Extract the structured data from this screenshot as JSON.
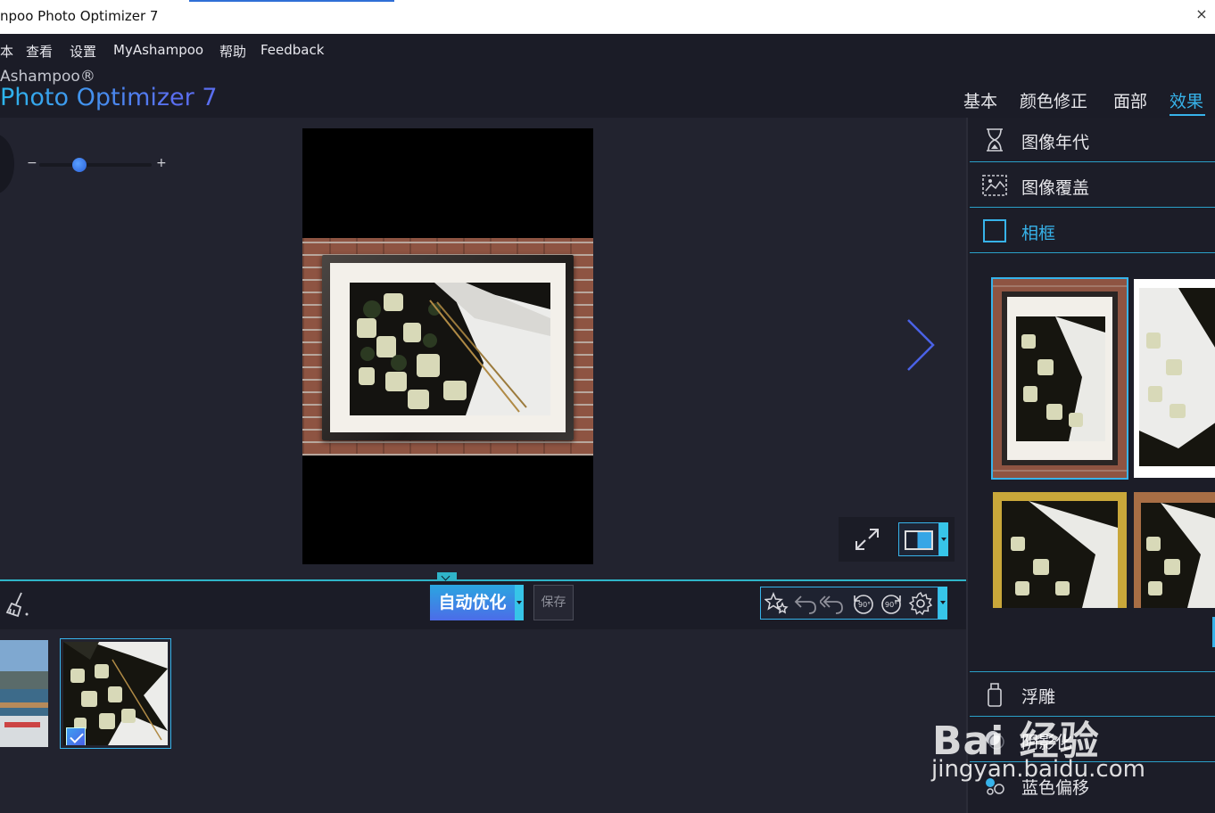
{
  "window": {
    "title": "npoo Photo Optimizer 7",
    "close_glyph": "×"
  },
  "menu": [
    "本",
    "查看",
    "设置",
    "MyAshampoo",
    "帮助",
    "Feedback"
  ],
  "brand": {
    "small": "Ashampoo®",
    "big": "Photo Optimizer 7"
  },
  "tabs": [
    "基本",
    "颜色修正",
    "面部",
    "效果"
  ],
  "active_tab": "效果",
  "zoom": {
    "minus": "−",
    "plus": "+",
    "level": 0.36
  },
  "toolbar": {
    "auto_label": "自动优化",
    "save_label": "保存"
  },
  "effects_top": [
    "图像年代",
    "图像覆盖",
    "相框"
  ],
  "active_effect": "相框",
  "effects_bottom": [
    "浮雕",
    "阴影化",
    "蓝色偏移"
  ],
  "watermark": {
    "line1": "Bai 经验",
    "line2": "jingyan.baidu.com"
  },
  "colors": {
    "accent": "#37b3ea",
    "brand_gradient": [
      "#2cb6ec",
      "#5a6ef0"
    ],
    "bg": "#22232f"
  },
  "icons": {
    "hourglass": "hourglass-icon",
    "overlay": "image-overlay-icon",
    "frame": "frame-icon",
    "emboss": "emboss-icon",
    "shadow": "shadow-icon",
    "blueshift": "blue-shift-icon"
  }
}
